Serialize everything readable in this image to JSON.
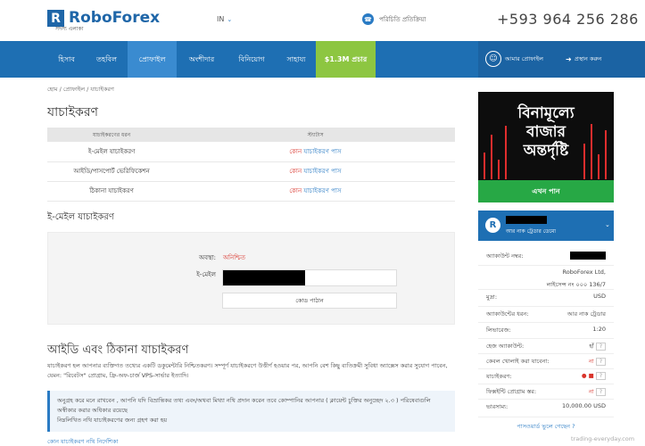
{
  "header": {
    "logo_text": "RoboForex",
    "logo_mark": "R",
    "logo_sub": "সদস্য এলাকা",
    "lang": "IN",
    "contact_label": "পরিচিতি প্রতিক্রিয়া",
    "phone": "+593 964 256 286"
  },
  "nav": {
    "items": [
      "হিসাব",
      "তহবিল",
      "প্রোফাইল",
      "অংশীদার",
      "বিনিয়োগ",
      "সাহায্য"
    ],
    "promo": "$1.3M প্রচার",
    "profile": "আমার প্রোফাইল",
    "exit": "প্রস্থান করুন"
  },
  "breadcrumb": "হোম / প্রোফাইল / যাচাইকরণ",
  "page_title": "যাচাইকরণ",
  "status_table": {
    "col1": "যাচাইকরণের ধরন",
    "col2": "স্ট্যাটাস",
    "rows": [
      {
        "type": "ই-মেইল যাচাইকরণ",
        "status_red": "কোন",
        "status_blue": "যাচাইকরণ পাস"
      },
      {
        "type": "আইডি/পাসপোর্ট ভেরিফিকেশন",
        "status_red": "কোন",
        "status_blue": "যাচাইকরণ পাস"
      },
      {
        "type": "ঠিকানা যাচাইকরণ",
        "status_red": "কোন",
        "status_blue": "যাচাইকরণ পাস"
      }
    ]
  },
  "email_section": {
    "title": "ই-মেইল যাচাইকরণ",
    "status_label": "অবস্থা:",
    "status_value": "অনিশ্চিত",
    "email_label": "ই-মেইল",
    "send_code": "কোড পাঠান"
  },
  "id_section": {
    "title": "আইডি এবং ঠিকানা যাচাইকরণ",
    "description": "যাচাইকরণ হল আপনার ব্যক্তিগত তথ্যের একটি ডকুমেন্টারি নিশ্চিতকরণ। সম্পূর্ণ যাচাইকরণে উত্তীর্ণ হওয়ার পর, আপনি বেশ কিছু ব্যতিক্রমী সুবিধা অ্যাক্সেস করার সুযোগ পাবেন, যেমন: \"রিবেটস\" প্রোগ্রাম, ফ্রি-অফ-চার্জ VPS-সার্ভার ইত্যাদি।",
    "notice_1": "অনুগ্রহ করে মনে রাখবেন , আপনি যদি বিভ্রান্তিকর তথ্য এবং/অথবা মিথ্যা নথি প্রদান করেন তবে কোম্পানির আপনার ( ক্লায়েন্ট চুক্তির অনুচ্ছেদ ২.৩ ) পরিষেবাগুলি অস্বীকার করার অধিকার রয়েছে",
    "notice_2": "নিম্নলিখিত নথি যাচাইকরণের জন্য গ্রহণ করা হয়",
    "bottom_link": "কোন যাচাইকরণ নথি নির্দেশিকা"
  },
  "banner": {
    "line1": "বিনামূল্যে",
    "line2": "বাজার",
    "line3": "অন্তর্দৃষ্টি",
    "button": "এখন পান"
  },
  "account": {
    "type": "আর নাক ট্রেডার ডেমো",
    "rows": [
      {
        "k": "অ্যাকাউন্ট নম্বর:",
        "v": ""
      },
      {
        "k": "",
        "v": "RoboForex Ltd,"
      },
      {
        "k": "",
        "v": "লাইসেন্স নং ০০০ 136/7"
      },
      {
        "k": "মুদ্রা:",
        "v": "USD"
      },
      {
        "k": "অ্যাকাউন্টের ধরন:",
        "v": "আর নাক ট্রেডার"
      },
      {
        "k": "লিভারেজ:",
        "v": "1:20"
      },
      {
        "k": "হেজ অ্যাকাউন্ট:",
        "v": "হাঁ"
      },
      {
        "k": "কেবল খোলাই করা যাবেনা:",
        "v": "না"
      },
      {
        "k": "যাচাইকরণ:",
        "v": ""
      },
      {
        "k": "ফিক্সইন্টি প্রোগ্রাম স্তর:",
        "v": "না"
      },
      {
        "k": "ভারসাম্য:",
        "v": "10,000.00 USD"
      }
    ],
    "q": "?",
    "password_link": "পাসওয়ার্ড ভুলে গেছেন ?"
  },
  "watermark": "trading-everyday.com",
  "colors": {
    "nav_blue": "#1e6fb3",
    "promo_green": "#8dc641",
    "status_red": "#d9342b",
    "link_blue": "#2a7bc4"
  }
}
